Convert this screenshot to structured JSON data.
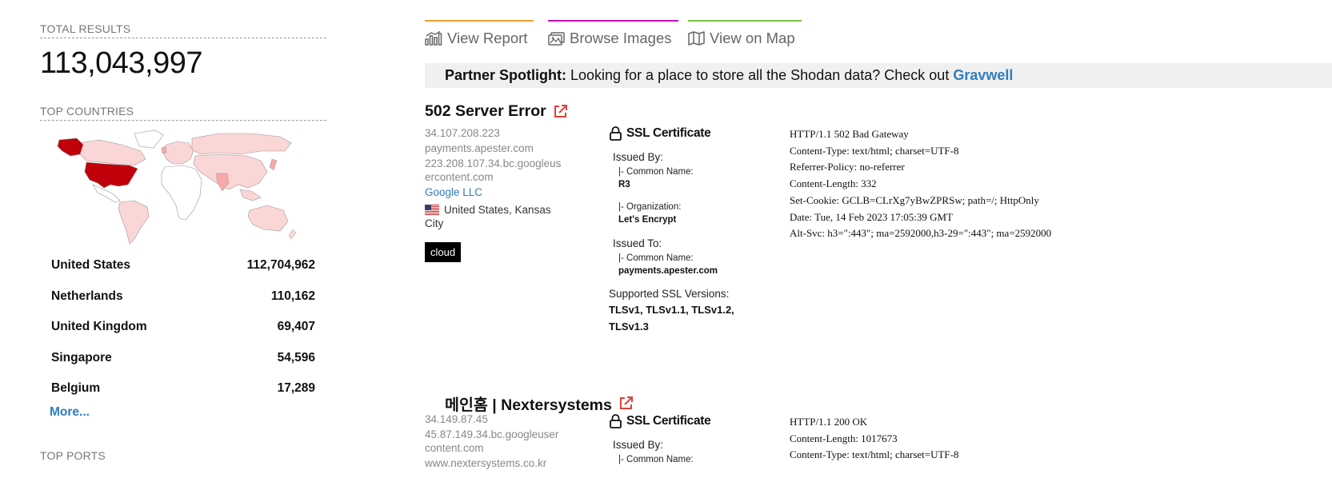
{
  "sidebar": {
    "total_results_title": "TOTAL RESULTS",
    "total_results_value": "113,043,997",
    "top_countries_title": "TOP COUNTRIES",
    "countries": [
      {
        "name": "United States",
        "count": "112,704,962"
      },
      {
        "name": "Netherlands",
        "count": "110,162"
      },
      {
        "name": "United Kingdom",
        "count": "69,407"
      },
      {
        "name": "Singapore",
        "count": "54,596"
      },
      {
        "name": "Belgium",
        "count": "17,289"
      }
    ],
    "more_label": "More...",
    "top_ports_title": "TOP PORTS"
  },
  "tabs": {
    "report": "View Report",
    "images": "Browse Images",
    "map": "View on Map"
  },
  "banner": {
    "lead": "Partner Spotlight:",
    "text": " Looking for a place to store all the Shodan data? Check out ",
    "link": "Gravwell"
  },
  "results": [
    {
      "title": "502 Server Error",
      "ip": "34.107.208.223",
      "hostnames": [
        "payments.apester.com",
        "223.208.107.34.bc.googleus",
        "ercontent.com"
      ],
      "org": "Google LLC",
      "location_line1": "United States, Kansas",
      "location_line2": "City",
      "tag": "cloud",
      "ssl": {
        "heading": "SSL Certificate",
        "issued_by_label": "Issued By:",
        "issuer_cn_label": "|- Common Name:",
        "issuer_cn": "R3",
        "issuer_org_label": "|- Organization:",
        "issuer_org": "Let's Encrypt",
        "issued_to_label": "Issued To:",
        "subject_cn_label": "|- Common Name:",
        "subject_cn": "payments.apester.com",
        "versions_label": "Supported SSL Versions:",
        "versions": "TLSv1, TLSv1.1, TLSv1.2, TLSv1.3"
      },
      "http": [
        "HTTP/1.1 502 Bad Gateway",
        "Content-Type: text/html; charset=UTF-8",
        "Referrer-Policy: no-referrer",
        "Content-Length: 332",
        "Set-Cookie: GCLB=CLrXg7yBwZPRSw; path=/; HttpOnly",
        "Date: Tue, 14 Feb 2023 17:05:39 GMT",
        "Alt-Svc: h3=\":443\"; ma=2592000,h3-29=\":443\"; ma=2592000"
      ]
    },
    {
      "title": "메인홈 | Nextersystems",
      "ip": "34.149.87.45",
      "hostnames": [
        "45.87.149.34.bc.googleuser",
        "content.com",
        "www.nextersystems.co.kr"
      ],
      "ssl": {
        "heading": "SSL Certificate",
        "issued_by_label": "Issued By:",
        "issuer_cn_label": "|- Common Name:"
      },
      "http": [
        "HTTP/1.1 200 OK",
        "Content-Length: 1017673",
        "Content-Type: text/html; charset=UTF-8"
      ]
    }
  ],
  "colors": {
    "link": "#2e7dbf",
    "map_us": "#c0000a",
    "map_light": "#f8c6c6",
    "external_link_icon": "#e0403a"
  }
}
